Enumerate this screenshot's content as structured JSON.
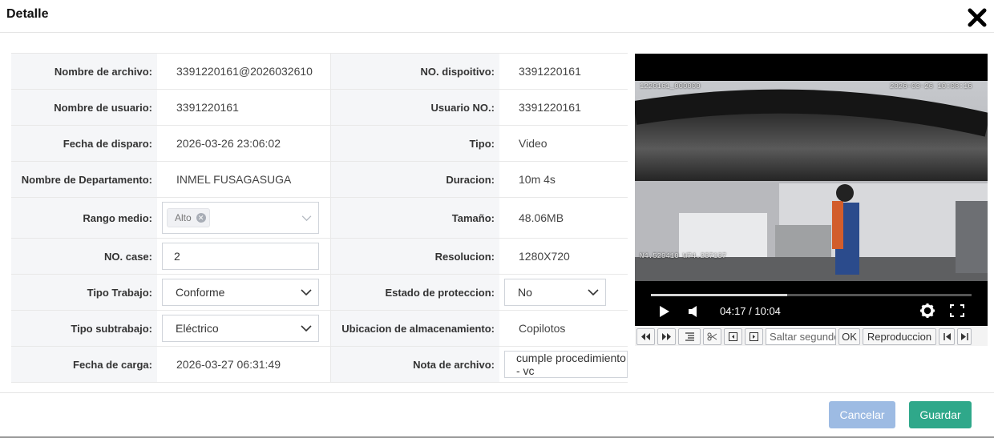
{
  "dialog": {
    "title": "Detalle"
  },
  "fields": {
    "file_name": {
      "label": "Nombre de archivo:",
      "value": "3391220161@2026032610"
    },
    "device_no": {
      "label": "NO. dispoitivo:",
      "value": "3391220161"
    },
    "user_name": {
      "label": "Nombre de usuario:",
      "value": "3391220161"
    },
    "user_no": {
      "label": "Usuario NO.:",
      "value": "3391220161"
    },
    "trigger_date": {
      "label": "Fecha de disparo:",
      "value": "2026-03-26 23:06:02"
    },
    "type": {
      "label": "Tipo:",
      "value": "Video"
    },
    "department": {
      "label": "Nombre de Departamento:",
      "value": "INMEL FUSAGASUGA"
    },
    "duration": {
      "label": "Duracion:",
      "value": "10m 4s"
    },
    "range": {
      "label": "Rango medio:",
      "tag": "Alto"
    },
    "size": {
      "label": "Tamaño:",
      "value": "48.06MB"
    },
    "case_no": {
      "label": "NO. case:",
      "value": "2"
    },
    "resolution": {
      "label": "Resolucion:",
      "value": "1280X720"
    },
    "work_type": {
      "label": "Tipo Trabajo:",
      "selected": "Conforme"
    },
    "protection": {
      "label": "Estado de proteccion:",
      "selected": "No"
    },
    "sub_work_type": {
      "label": "Tipo subtrabajo:",
      "selected": "Eléctrico"
    },
    "storage": {
      "label": "Ubicacion de almacenamiento:",
      "value": "Copilotos"
    },
    "upload_date": {
      "label": "Fecha de carga:",
      "value": "2026-03-27 06:31:49"
    },
    "file_note": {
      "label": "Nota de archivo:",
      "value": "cumple procedimiento - vc"
    }
  },
  "player": {
    "osd_top_left": "1220161_000000",
    "osd_top_right": "2026-03-26 10:08:16",
    "osd_coords": "N4.529410  W74.237137",
    "current_time": "04:17",
    "total_time": "10:04",
    "time_display": "04:17 / 10:04",
    "progress": 0.425
  },
  "toolbar": {
    "jump_placeholder": "Saltar segundos",
    "ok_label": "OK",
    "playback_label": "Reproduccion"
  },
  "footer": {
    "cancel_label": "Cancelar",
    "save_label": "Guardar"
  },
  "colors": {
    "save": "#2fa88a",
    "cancel": "#9dbbe3",
    "label_bg": "#f5f6f8"
  }
}
